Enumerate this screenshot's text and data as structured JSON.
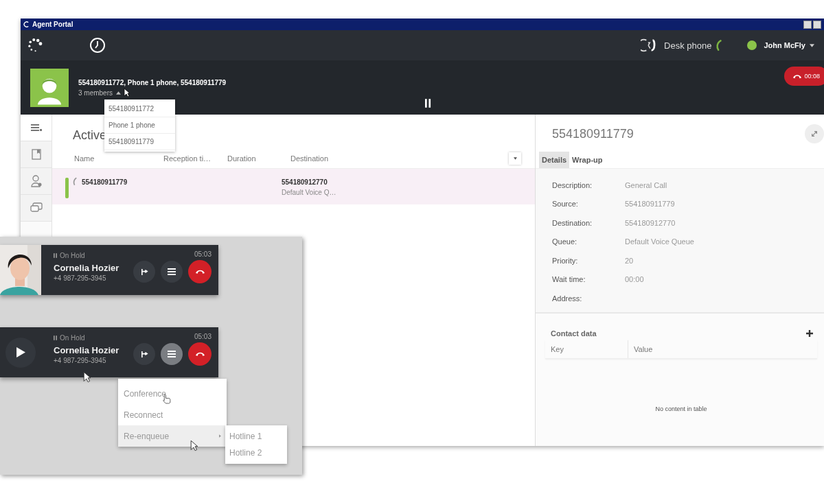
{
  "window": {
    "title": "Agent Portal"
  },
  "top_bar": {
    "device": "Desk phone",
    "user": "John McFly"
  },
  "call": {
    "participants": "554180911772, Phone 1 phone, 554180911779",
    "members_label": "3 members",
    "members_expanded": true,
    "timer": "00:08",
    "members": [
      "554180911772",
      "Phone 1 phone",
      "554180911779"
    ]
  },
  "sidebar": {
    "items": [
      {
        "kind": "list",
        "selected": true
      },
      {
        "kind": "book",
        "selected": false
      },
      {
        "kind": "contact",
        "selected": false
      },
      {
        "kind": "chat",
        "selected": false
      }
    ]
  },
  "active_list": {
    "title": "Active",
    "columns": [
      "Name",
      "Reception ti…",
      "Duration",
      "Destination"
    ],
    "rows": [
      {
        "name": "554180911779",
        "destination": "554180912770",
        "queue": "Default Voice Q…",
        "selected": true
      }
    ]
  },
  "details": {
    "title": "554180911779",
    "tabs": [
      {
        "label": "Details",
        "selected": true
      },
      {
        "label": "Wrap-up",
        "selected": false
      }
    ],
    "fields": [
      {
        "label": "Description:",
        "value": "General Call"
      },
      {
        "label": "Source:",
        "value": "554180911779"
      },
      {
        "label": "Destination:",
        "value": "554180912770"
      },
      {
        "label": "Queue:",
        "value": "Default Voice Queue"
      },
      {
        "label": "Priority:",
        "value": "20"
      },
      {
        "label": "Wait time:",
        "value": "00:00"
      },
      {
        "label": "Address:"
      }
    ],
    "contact_data": {
      "title": "Contact data",
      "columns": [
        "Key",
        "Value"
      ],
      "empty_text": "No content in table"
    }
  },
  "overlay": {
    "cards": [
      {
        "status": "On Hold",
        "time": "05:03",
        "name": "Cornelia Hozier",
        "number": "+4 987-295-3945",
        "menu_open": false
      },
      {
        "kind": "play",
        "status": "On Hold",
        "time": "05:03",
        "name": "Cornelia Hozier",
        "number": "+4 987-295-3945",
        "menu_open": true
      }
    ],
    "menu": {
      "items": [
        {
          "label": "Conference",
          "selected": false
        },
        {
          "label": "Reconnect",
          "selected": false
        },
        {
          "label": "Re-enqueue",
          "selected": true,
          "children": [
            {
              "label": "Hotline 1"
            },
            {
              "label": "Hotline 2"
            }
          ]
        }
      ]
    }
  }
}
